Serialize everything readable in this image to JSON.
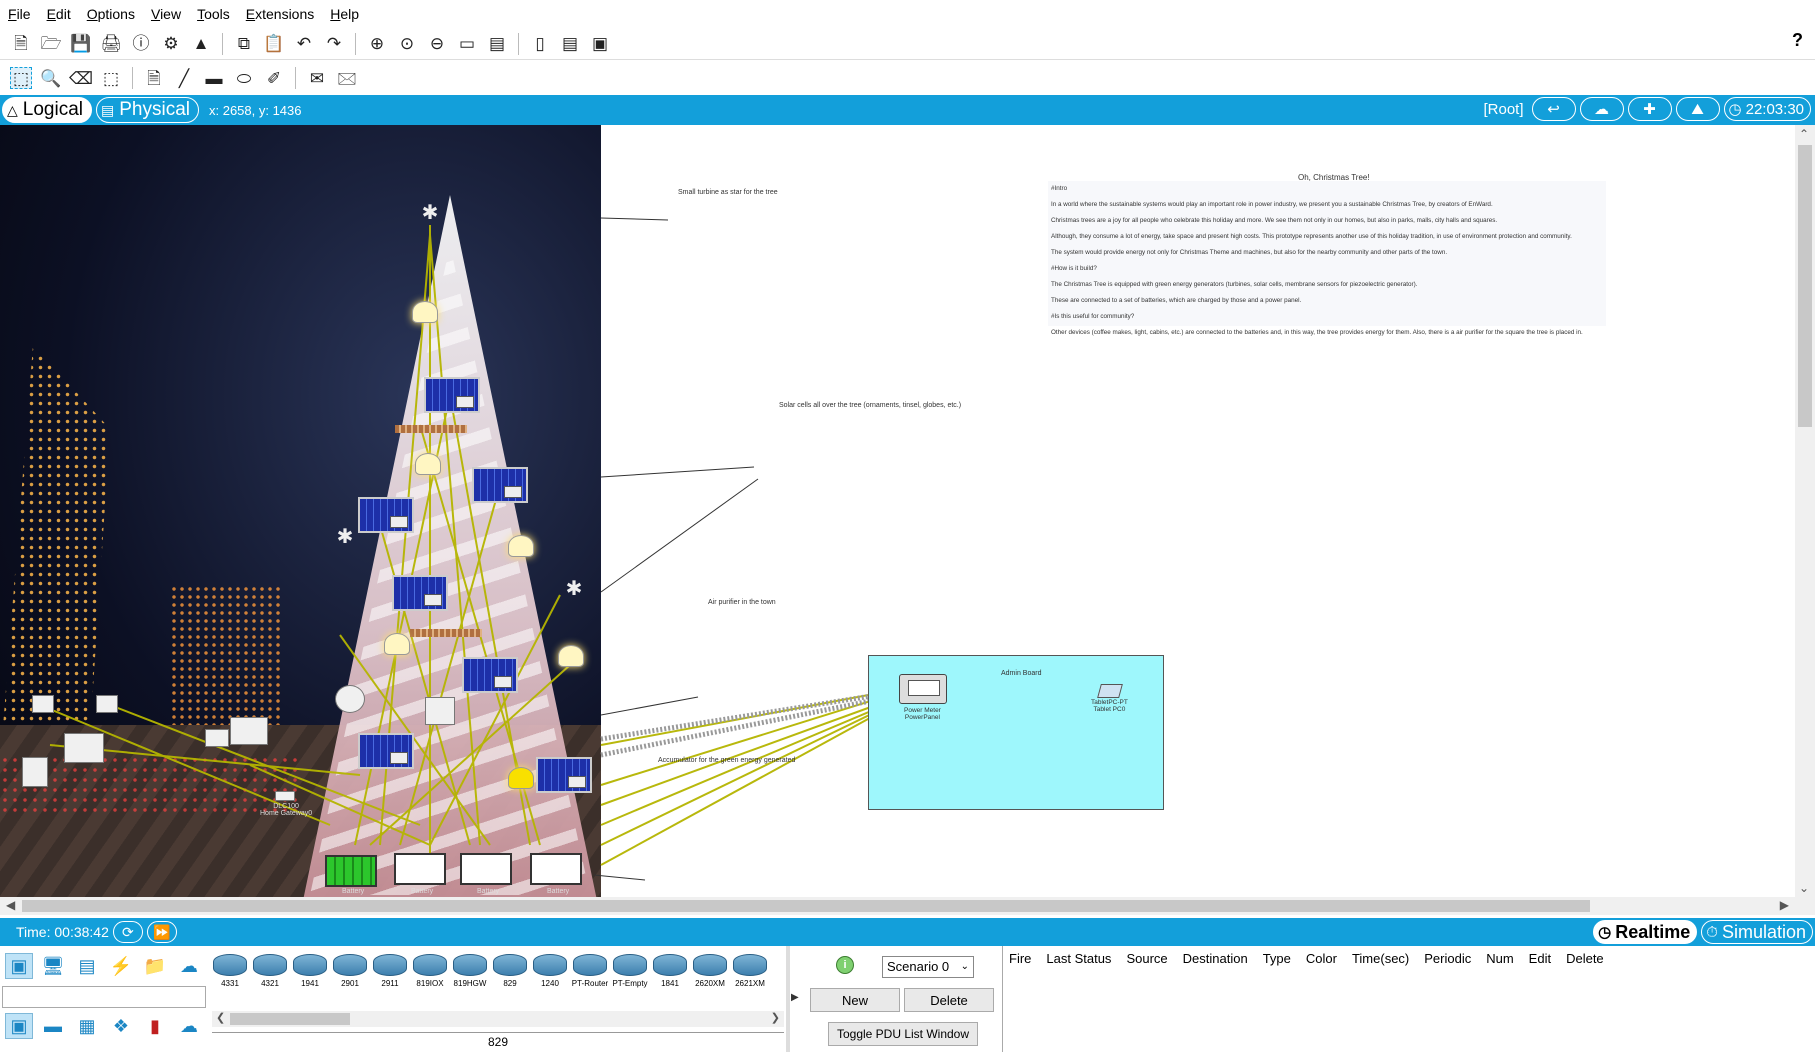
{
  "menu": [
    "File",
    "Edit",
    "Options",
    "View",
    "Tools",
    "Extensions",
    "Help"
  ],
  "toolbar_main_icons": [
    "new-icon",
    "open-icon",
    "save-icon",
    "print-icon",
    "info-icon",
    "network-wizard-icon",
    "activity-wizard-icon",
    "copy-icon",
    "paste-icon",
    "undo-icon",
    "redo-icon",
    "zoom-in-icon",
    "zoom-reset-icon",
    "zoom-out-icon",
    "drawing-palette-icon",
    "custom-device-icon",
    "device-dialog-icon",
    "pdu-dialog-icon",
    "viewport-icon"
  ],
  "toolbar_tools_icons": [
    "select-icon",
    "inspect-icon",
    "delete-icon",
    "resize-icon",
    "note-icon",
    "line-icon",
    "rectangle-icon",
    "ellipse-icon",
    "freeform-icon",
    "simple-pdu-icon",
    "complex-pdu-icon"
  ],
  "help_mark": "?",
  "workspace": {
    "logical_tab": "Logical",
    "physical_tab": "Physical",
    "coords": "x: 2658, y: 1436",
    "root_label": "[Root]",
    "clock": "22:03:30"
  },
  "canvas": {
    "title_note": "Oh, Christmas Tree!",
    "notes": [
      "#Intro",
      "In a world where the sustainable systems would play an important role in power industry, we present you a sustainable Christmas Tree, by creators of EnWard.",
      "Christmas trees are a joy for all people who celebrate this holiday and more. We see them not only in our homes, but also in parks, malls, city halls and squares.",
      "Although, they consume a lot of energy, take space and present high costs. This prototype represents another use of this holiday tradition, in use of environment protection and community.",
      "The system would provide energy not only for Christmas Theme and machines, but also for the nearby community and other parts of the town.",
      "#How is it build?",
      "The Christmas Tree is equipped with green energy generators (turbines, solar cells, membrane sensors for piezoelectric generator).",
      "These are connected to a set of batteries, which are charged by those and a power panel.",
      "#Is this useful for community?",
      "Other devices (coffee makes, light, cabins, etc.) are connected to the batteries and, in this way, the tree provides energy for them. Also, there is a air purifier for the square the tree is placed in."
    ],
    "annotations": {
      "turbine_star": "Small turbine as star for the tree",
      "solar_cells": "Solar cells all over the tree (ornaments, tinsel, globes, etc.)",
      "air_purifier": "Air purifier in the town",
      "accumulator": "Accumulator for the green energy generated"
    },
    "cluster": {
      "label": "Admin Board",
      "power_meter_label": [
        "Power Meter",
        "PowerPanel"
      ],
      "tablet_label": [
        "TabletPC-PT",
        "Tablet PC0"
      ]
    },
    "device_labels": {
      "home_gateway": [
        "DLC100",
        "Home Gateway0"
      ],
      "battery": "Battery"
    }
  },
  "status": {
    "time": "Time: 00:38:42",
    "realtime": "Realtime",
    "simulation": "Simulation"
  },
  "devices": [
    "4331",
    "4321",
    "1941",
    "2901",
    "2911",
    "819IOX",
    "819HGW",
    "829",
    "1240",
    "PT-Router",
    "PT-Empty",
    "1841",
    "2620XM",
    "2621XM"
  ],
  "selected_device": "829",
  "scenario": {
    "value": "Scenario 0",
    "new_label": "New",
    "delete_label": "Delete",
    "toggle_label": "Toggle PDU List Window"
  },
  "pdu_columns": [
    "Fire",
    "Last Status",
    "Source",
    "Destination",
    "Type",
    "Color",
    "Time(sec)",
    "Periodic",
    "Num",
    "Edit",
    "Delete"
  ],
  "colors": {
    "accent_blue": "#139fda",
    "cluster_cyan": "#9ef7fc",
    "link_olive": "#b5b500"
  }
}
